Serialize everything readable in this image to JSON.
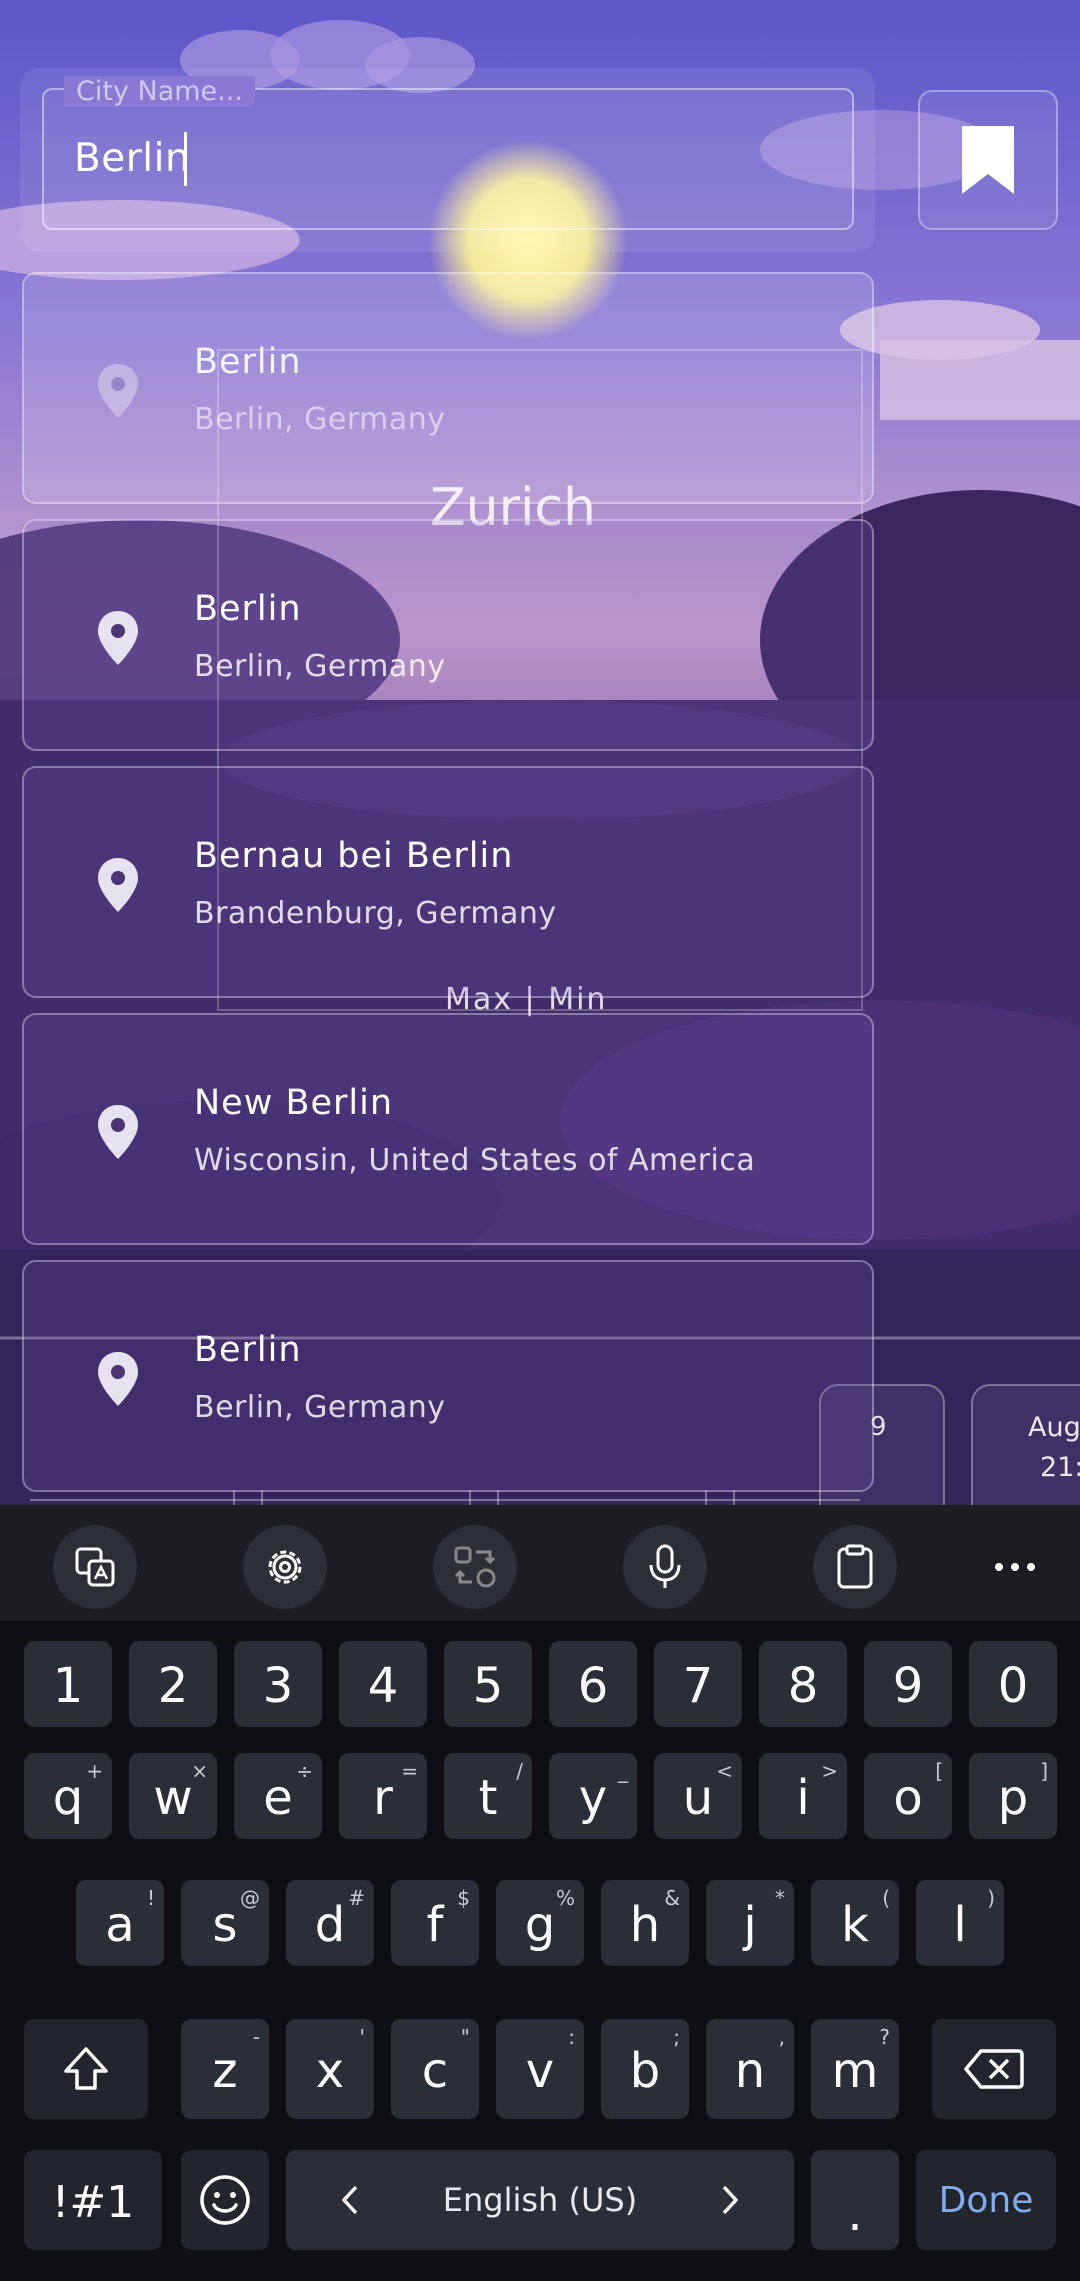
{
  "search": {
    "placeholder": "City Name...",
    "value": "Berlin"
  },
  "bookmark": {
    "icon": "bookmark-icon"
  },
  "suggestions": [
    {
      "title": "Berlin",
      "subtitle": "Berlin, Germany"
    },
    {
      "title": "Berlin",
      "subtitle": "Berlin, Germany"
    },
    {
      "title": "Bernau bei Berlin",
      "subtitle": "Brandenburg, Germany"
    },
    {
      "title": "New Berlin",
      "subtitle": "Wisconsin, United States of America"
    },
    {
      "title": "Berlin",
      "subtitle": "Berlin, Germany"
    }
  ],
  "background": {
    "city_partial": "Zurich",
    "maxmin_partial": "Max | Min",
    "card_partial_1": "9",
    "card_partial_2_line1": "Aug",
    "card_partial_2_line2": "21:"
  },
  "keyboard": {
    "toolbar": [
      "translate-icon",
      "settings-icon",
      "convert-icon",
      "mic-icon",
      "clipboard-icon",
      "more-icon"
    ],
    "row_numbers": [
      "1",
      "2",
      "3",
      "4",
      "5",
      "6",
      "7",
      "8",
      "9",
      "0"
    ],
    "row_top": [
      {
        "k": "q",
        "s": "+"
      },
      {
        "k": "w",
        "s": "×"
      },
      {
        "k": "e",
        "s": "÷"
      },
      {
        "k": "r",
        "s": "="
      },
      {
        "k": "t",
        "s": "/"
      },
      {
        "k": "y",
        "s": "_"
      },
      {
        "k": "u",
        "s": "<"
      },
      {
        "k": "i",
        "s": ">"
      },
      {
        "k": "o",
        "s": "["
      },
      {
        "k": "p",
        "s": "]"
      }
    ],
    "row_mid": [
      {
        "k": "a",
        "s": "!"
      },
      {
        "k": "s",
        "s": "@"
      },
      {
        "k": "d",
        "s": "#"
      },
      {
        "k": "f",
        "s": "$"
      },
      {
        "k": "g",
        "s": "%"
      },
      {
        "k": "h",
        "s": "&"
      },
      {
        "k": "j",
        "s": "*"
      },
      {
        "k": "k",
        "s": "("
      },
      {
        "k": "l",
        "s": ")"
      }
    ],
    "row_bottom": [
      {
        "k": "z",
        "s": "-"
      },
      {
        "k": "x",
        "s": "'"
      },
      {
        "k": "c",
        "s": "\""
      },
      {
        "k": "v",
        "s": ":"
      },
      {
        "k": "b",
        "s": ";"
      },
      {
        "k": "n",
        "s": ","
      },
      {
        "k": "m",
        "s": "?"
      }
    ],
    "symbols_label": "!#1",
    "language_label": "English (US)",
    "period_label": ".",
    "done_label": "Done"
  },
  "colors": {
    "sky_top": "#5c55c8",
    "hill_dark": "#3c2a66",
    "keyboard_bg": "#0e0f12",
    "key_bg": "#2a2e36",
    "done_blue": "#7faef0"
  }
}
